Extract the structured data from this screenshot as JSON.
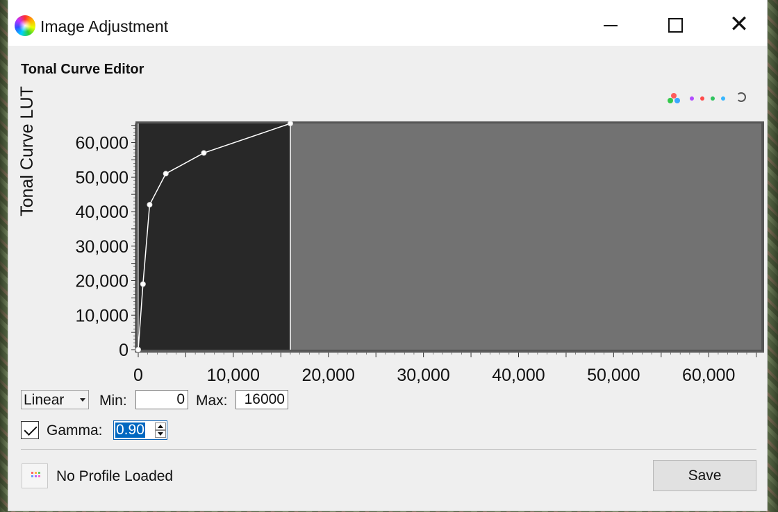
{
  "window": {
    "title": "Image Adjustment",
    "close_symbol": "✕"
  },
  "editor": {
    "title": "Tonal Curve Editor",
    "tool_icons": [
      "rgb-channel-icon",
      "purple-channel-icon",
      "red-channel-icon",
      "green-channel-icon",
      "cyan-channel-icon",
      "reset-curve-icon"
    ]
  },
  "chart_data": {
    "type": "line",
    "title": "",
    "xlabel": "",
    "ylabel": "Tonal Curve LUT",
    "xlim": [
      0,
      65535
    ],
    "ylim": [
      0,
      65535
    ],
    "x_tick_values": [
      0,
      10000,
      20000,
      30000,
      40000,
      50000,
      60000
    ],
    "x_tick_labels": [
      "0",
      "10,000",
      "20,000",
      "30,000",
      "40,000",
      "50,000",
      "60,000"
    ],
    "y_tick_values": [
      0,
      10000,
      20000,
      30000,
      40000,
      50000,
      60000
    ],
    "y_tick_labels": [
      "0",
      "10,000",
      "20,000",
      "30,000",
      "40,000",
      "50,000",
      "60,000"
    ],
    "active_range": [
      0,
      16000
    ],
    "series": [
      {
        "x": [
          0,
          500,
          1200,
          2900,
          6900,
          16000
        ],
        "y": [
          0,
          19000,
          42000,
          51000,
          57000,
          65535
        ]
      }
    ],
    "grid": false,
    "legend": "none",
    "colors": {
      "plot_background": "#727272",
      "active_background": "#282828",
      "curve": "#ffffff"
    }
  },
  "controls": {
    "mode": "Linear",
    "min_label": "Min:",
    "min_value": "0",
    "max_label": "Max:",
    "max_value": "16000",
    "gamma_label": "Gamma:",
    "gamma_checked": true,
    "gamma_value": "0.90"
  },
  "footer": {
    "profile_text": "No Profile Loaded",
    "save_label": "Save"
  }
}
